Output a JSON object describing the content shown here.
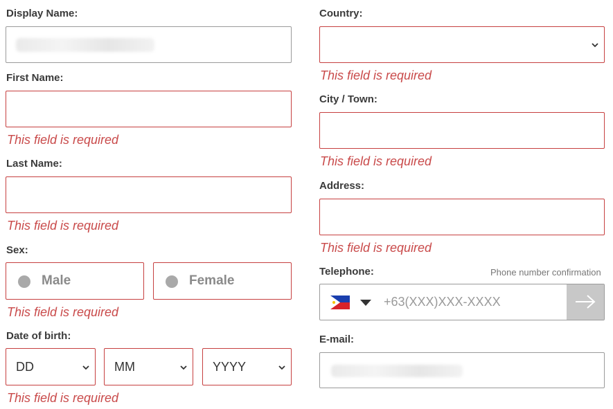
{
  "display_name": {
    "label": "Display Name:"
  },
  "first_name": {
    "label": "First Name:",
    "error": "This field is required"
  },
  "last_name": {
    "label": "Last Name:",
    "error": "This field is required"
  },
  "sex": {
    "label": "Sex:",
    "options": [
      "Male",
      "Female"
    ],
    "error": "This field is required"
  },
  "dob": {
    "label": "Date of birth:",
    "day": "DD",
    "month": "MM",
    "year": "YYYY",
    "error": "This field is required"
  },
  "country": {
    "label": "Country:",
    "error": "This field is required"
  },
  "city": {
    "label": "City / Town:",
    "error": "This field is required"
  },
  "address": {
    "label": "Address:",
    "error": "This field is required"
  },
  "telephone": {
    "label": "Telephone:",
    "confirm_label": "Phone number confirmation",
    "placeholder": "+63(XXX)XXX-XXXX",
    "flag": "philippines-flag-icon"
  },
  "email": {
    "label": "E-mail:"
  },
  "colors": {
    "error": "#c94a4a",
    "border_error": "#c63f3f",
    "border_neutral": "#9a9a9a"
  }
}
